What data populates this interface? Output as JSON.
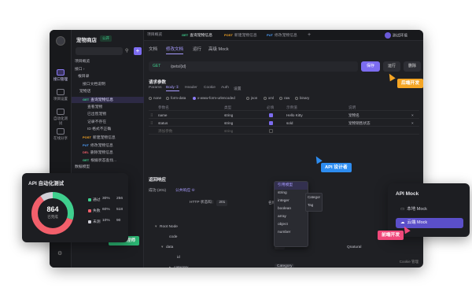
{
  "sidebar": {
    "items": [
      {
        "label": "接口管理"
      },
      {
        "label": "项目设置"
      },
      {
        "label": "自动化测试"
      },
      {
        "label": "在线分享"
      }
    ]
  },
  "project": {
    "title": "宠物商店",
    "badge": "公开"
  },
  "tree": {
    "rows": [
      {
        "indent": 4,
        "method": "",
        "label": "项目概览"
      },
      {
        "indent": 4,
        "method": "",
        "label": "接口 ›"
      },
      {
        "indent": 8,
        "method": "",
        "label": "根目录"
      },
      {
        "indent": 14,
        "method": "",
        "label": "接口文档说明"
      },
      {
        "indent": 10,
        "method": "",
        "label": "宠物店"
      },
      {
        "indent": 14,
        "method": "GET",
        "label": "查询宠物信息",
        "selected": true
      },
      {
        "indent": 20,
        "method": "",
        "label": "查看宠物"
      },
      {
        "indent": 20,
        "method": "",
        "label": "已出售宠物"
      },
      {
        "indent": 20,
        "method": "",
        "label": "记录不存在"
      },
      {
        "indent": 20,
        "method": "",
        "label": "ID 格式不正确"
      },
      {
        "indent": 14,
        "method": "POST",
        "label": "新建宠物信息"
      },
      {
        "indent": 14,
        "method": "PUT",
        "label": "修改宠物信息"
      },
      {
        "indent": 14,
        "method": "DEL",
        "label": "删除宠物信息"
      },
      {
        "indent": 14,
        "method": "GET",
        "label": "根据状态查找..."
      },
      {
        "indent": 4,
        "method": "",
        "label": "数据模型"
      }
    ]
  },
  "tabs": [
    {
      "label": "项目概览",
      "method": ""
    },
    {
      "label": "查询宠物信息",
      "method": "GET"
    },
    {
      "label": "新建宠物信息",
      "method": "POST"
    },
    {
      "label": "修改宠物信息",
      "method": "PUT"
    }
  ],
  "env": "测试环境",
  "subtabs": [
    "文档",
    "修改文档",
    "运行",
    "高级 Mock"
  ],
  "request": {
    "method": "GET",
    "path": "/pets/{id}",
    "save_label": "保存",
    "run_label": "运行",
    "delete_label": "删除",
    "params_title": "请求参数",
    "param_tabs": [
      "Params",
      "Body ①",
      "Header",
      "Cookie",
      "Auth",
      "设置"
    ],
    "body_types": [
      "none",
      "form-data",
      "x-www-form-urlencoded",
      "json",
      "xml",
      "raw",
      "binary"
    ],
    "headers": [
      "参数名",
      "类型",
      "必填",
      "示例值",
      "说明"
    ],
    "rows": [
      {
        "name": "name",
        "type": "string",
        "example": "Hello Kitty",
        "desc": "宠物名"
      },
      {
        "name": "status",
        "type": "string",
        "example": "sold",
        "desc": "宠物销售状态"
      },
      {
        "name": "添加参数",
        "type": "string",
        "example": "",
        "desc": ""
      }
    ]
  },
  "response": {
    "title": "返回响应",
    "tabs": [
      "成功 (201)",
      "公共响应 ⑥"
    ],
    "add_label": "+ 添加",
    "http_label": "HTTP 状态码：",
    "http_value": "201",
    "name_label": "名称",
    "json_hint": "JSON 导入",
    "schema_rows": [
      {
        "name": "Root Node",
        "type": "",
        "indent": 0
      },
      {
        "name": "code",
        "type": "",
        "indent": 12
      },
      {
        "name": "data",
        "type": "Pet",
        "indent": 6
      },
      {
        "name": "id",
        "type": "",
        "indent": 18
      },
      {
        "name": "category",
        "type": "Category",
        "indent": 12
      }
    ],
    "row_values": [
      "Qnatural"
    ]
  },
  "type_dropdown": {
    "header": "引用模型",
    "items": [
      "string",
      "integer",
      "boolean",
      "array",
      "object",
      "number"
    ]
  },
  "type_dropdown2": {
    "items": [
      "Categor",
      "Tag"
    ]
  },
  "footer_hint": "Cookie 管理",
  "test_card": {
    "title": "API 自动化测试",
    "total": "864",
    "total_label": "已完成",
    "stats": [
      {
        "label": "通过",
        "pct": "30%",
        "count": "256",
        "color": "#3fcf8e"
      },
      {
        "label": "失败",
        "pct": "60%",
        "count": "518",
        "color": "#f25f6b"
      },
      {
        "label": "未测",
        "pct": "10%",
        "count": "90",
        "color": "#d0d0d8"
      }
    ],
    "donut": {
      "pass": 0.3,
      "fail": 0.6,
      "none": 0.1
    }
  },
  "mock_card": {
    "title": "API Mock",
    "items": [
      {
        "label": "本地 Mock",
        "active": false
      },
      {
        "label": "云端 Mock",
        "active": true
      }
    ]
  },
  "role_tags": {
    "backend": "后端开发",
    "designer": "API 设计者",
    "tester": "测试工程师",
    "frontend": "前端开发"
  },
  "colors": {
    "accent": "#7c6cf0",
    "backend_tag": "#f5a524",
    "designer_tag": "#2d8cf0",
    "tester_tag": "#2bb673",
    "frontend_tag": "#f0487a"
  }
}
